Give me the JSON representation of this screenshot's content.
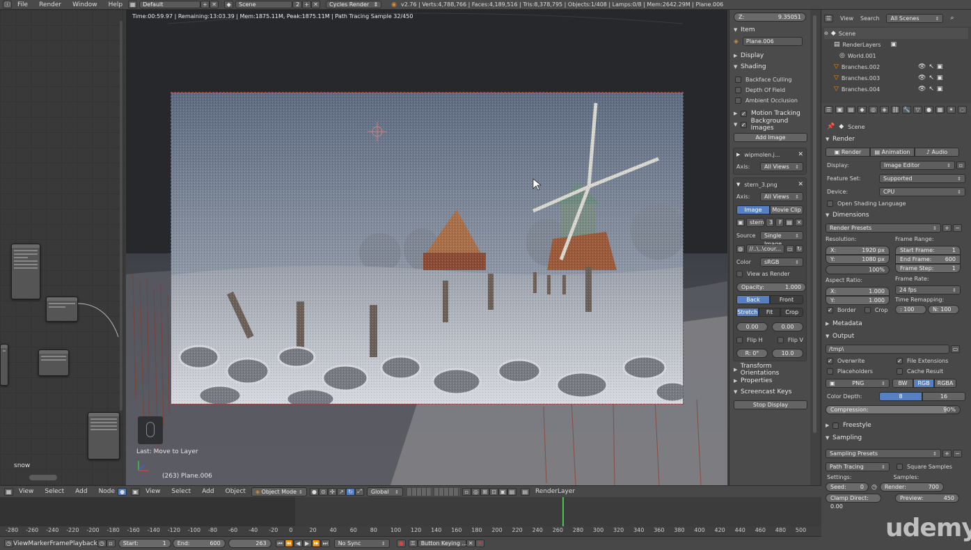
{
  "topbar": {
    "menus": [
      "File",
      "Render",
      "Window",
      "Help"
    ],
    "layout": "Default",
    "scene": "Scene",
    "scene_num": "2",
    "engine": "Cycles Render",
    "stats": "v2.76 | Verts:4,788,766 | Faces:4,189,516 | Tris:8,378,795 | Objects:1/408 | Lamps:0/8 | Mem:2642.29M | Plane.006"
  },
  "viewport": {
    "status": "Time:00:59.97 | Remaining:13:03.39 | Mem:1875.11M, Peak:1875.11M | Path Tracing Sample 32/450",
    "last_op": "Last: Move to Layer",
    "object_info": "(263) Plane.006"
  },
  "node_editor": {
    "label": "snow"
  },
  "npanel": {
    "z_label": "Z:",
    "z_value": "9.35051",
    "item_title": "Item",
    "item_name": "Plane.006",
    "display_title": "Display",
    "shading_title": "Shading",
    "backface": "Backface Culling",
    "depth_field": "Depth Of Field",
    "ambient": "Ambient Occlusion",
    "motion": "Motion Tracking",
    "bg_images": "Background Images",
    "add_image": "Add Image",
    "img1_name": "wipmolen.j...",
    "axis_label": "Axis:",
    "axis_value": "All Views",
    "img2_name": "stern_3.png",
    "tab_image": "Image",
    "tab_clip": "Movie Clip",
    "img_field": "stern",
    "img_users": "3",
    "img_f": "F",
    "source_label": "Source",
    "source_value": "Single Image",
    "path_value": "//..\\..\\cour...",
    "color_label": "Color",
    "color_value": "sRGB",
    "view_render": "View as Render",
    "opacity": "Opacity:",
    "opacity_value": "1.000",
    "back": "Back",
    "front": "Front",
    "stretch": "Stretch",
    "fit": "Fit",
    "crop": "Crop",
    "offx": "0.00",
    "offy": "0.00",
    "fliph": "Flip H",
    "flipv": "Flip V",
    "rot": "R: 0°",
    "size": "10.0",
    "transform_orient": "Transform Orientations",
    "properties": "Properties",
    "screencast": "Screencast Keys",
    "stop_display": "Stop Display"
  },
  "outliner": {
    "view": "View",
    "search": "Search",
    "scope": "All Scenes",
    "items": [
      "Scene",
      "RenderLayers",
      "World.001",
      "Branches.002",
      "Branches.003",
      "Branches.004"
    ]
  },
  "props": {
    "scene": "Scene",
    "render_title": "Render",
    "render_btn": "Render",
    "anim_btn": "Animation",
    "audio_btn": "Audio",
    "display_label": "Display:",
    "display_value": "Image Editor",
    "feature_label": "Feature Set:",
    "feature_value": "Supported",
    "device_label": "Device:",
    "device_value": "CPU",
    "osl": "Open Shading Language",
    "dimensions": "Dimensions",
    "render_presets": "Render Presets",
    "resolution": "Resolution:",
    "res_x": "1920 px",
    "res_y": "1080 px",
    "res_pct": "100%",
    "x_lbl": "X:",
    "y_lbl": "Y:",
    "frame_range": "Frame Range:",
    "start_frame": "Start Frame:",
    "start_val": "1",
    "end_frame": "End Frame:",
    "end_val": "600",
    "frame_step": "Frame Step:",
    "step_val": "1",
    "aspect": "Aspect Ratio:",
    "asp_x": "1.000",
    "asp_y": "1.000",
    "frame_rate": "Frame Rate:",
    "fps": "24 fps",
    "time_remap": "Time Remapping:",
    "remap_old": ": 100",
    "remap_new": "N: 100",
    "border": "Border",
    "crop": "Crop",
    "metadata": "Metadata",
    "output": "Output",
    "output_path": "/tmp\\",
    "overwrite": "Overwrite",
    "file_ext": "File Extensions",
    "placeholders": "Placeholders",
    "cache": "Cache Result",
    "format": "PNG",
    "bw": "BW",
    "rgb": "RGB",
    "rgba": "RGBA",
    "depth_label": "Color Depth:",
    "depth_8": "8",
    "depth_16": "16",
    "compression": "Compression:",
    "compression_val": "90%",
    "freestyle": "Freestyle",
    "sampling": "Sampling",
    "sampling_presets": "Sampling Presets",
    "path_tracing": "Path Tracing",
    "square": "Square Samples",
    "settings": "Settings:",
    "seed": "Seed:",
    "seed_val": "0",
    "samples_label": "Samples:",
    "render_s": "Render:",
    "render_s_val": "700",
    "clamp": "Clamp Direct: 0.00",
    "preview": "Preview:",
    "preview_val": "450"
  },
  "bottom_node": {
    "menus": [
      "View",
      "Select",
      "Add",
      "Node"
    ]
  },
  "bottom_3d": {
    "menus": [
      "View",
      "Select",
      "Add",
      "Object"
    ],
    "mode": "Object Mode",
    "orient": "Global",
    "renderlayer": "RenderLayer"
  },
  "timeline": {
    "ticks": [
      "-280",
      "-260",
      "-240",
      "-220",
      "-200",
      "-180",
      "-160",
      "-140",
      "-120",
      "-100",
      "-80",
      "-60",
      "-40",
      "-20",
      "0",
      "20",
      "40",
      "60",
      "80",
      "100",
      "120",
      "140",
      "160",
      "180",
      "200",
      "220",
      "240",
      "260",
      "280",
      "300",
      "320",
      "340",
      "360",
      "380",
      "400",
      "420",
      "440",
      "460",
      "480",
      "500"
    ],
    "menus": [
      "View",
      "Marker",
      "Frame",
      "Playback"
    ],
    "start_label": "Start:",
    "start": "1",
    "end_label": "End:",
    "end": "600",
    "current": "263",
    "sync": "No Sync",
    "keying": "Button Keying ..."
  },
  "watermark": "udemy",
  "colors": {
    "accent": "#5680c2",
    "current_frame": "#4fc24f"
  }
}
